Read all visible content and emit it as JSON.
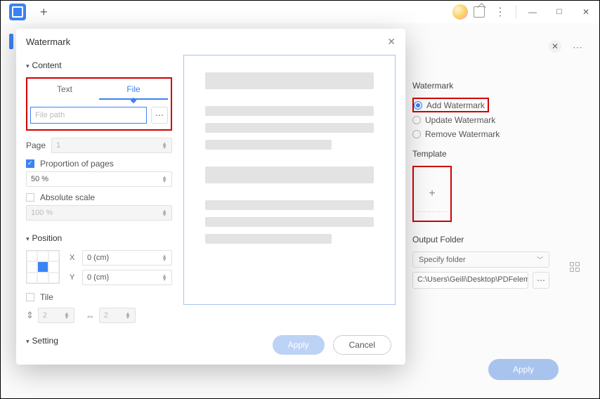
{
  "modal": {
    "title": "Watermark",
    "sections": {
      "content": "Content",
      "position": "Position",
      "setting": "Setting"
    },
    "tabs": {
      "text": "Text",
      "file": "File"
    },
    "file_placeholder": "File path",
    "page_label": "Page",
    "page_value": "1",
    "proportion_label": "Proportion of pages",
    "proportion_value": "50 %",
    "absolute_label": "Absolute scale",
    "absolute_value": "100 %",
    "x_label": "X",
    "x_value": "0 (cm)",
    "y_label": "Y",
    "y_value": "0 (cm)",
    "tile_label": "Tile",
    "tile_val": "2",
    "apply": "Apply",
    "cancel": "Cancel"
  },
  "panel": {
    "title": "Watermark",
    "add": "Add Watermark",
    "update": "Update Watermark",
    "remove": "Remove Watermark",
    "template": "Template",
    "output": "Output Folder",
    "specify": "Specify folder",
    "path": "C:\\Users\\Geili\\Desktop\\PDFelement\\W…",
    "apply": "Apply"
  }
}
